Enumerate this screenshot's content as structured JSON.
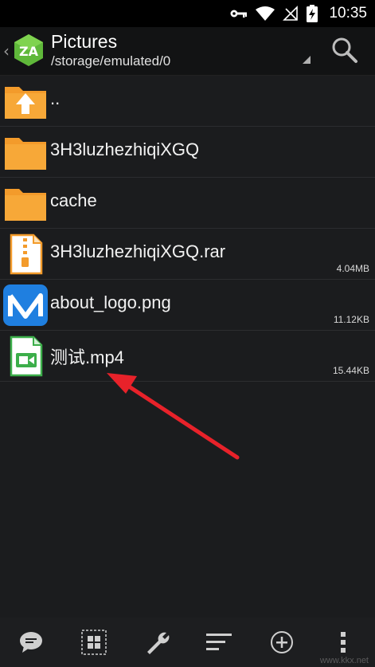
{
  "status_bar": {
    "time": "10:35",
    "icons": [
      "key-icon",
      "wifi-icon",
      "no-sim-icon",
      "battery-charging-icon"
    ]
  },
  "app_bar": {
    "title": "Pictures",
    "path": "/storage/emulated/0",
    "logo": "zarchiver-logo",
    "accent_color": "#5fb83a"
  },
  "files": [
    {
      "name": "..",
      "size": "",
      "icon": "folder-up-icon"
    },
    {
      "name": "3H3luzhezhiqiXGQ",
      "size": "",
      "icon": "folder-icon"
    },
    {
      "name": "cache",
      "size": "",
      "icon": "folder-icon"
    },
    {
      "name": "3H3luzhezhiqiXGQ.rar",
      "size": "4.04MB",
      "icon": "archive-file-icon"
    },
    {
      "name": "about_logo.png",
      "size": "11.12KB",
      "icon": "image-app-logo-icon"
    },
    {
      "name": "测试.mp4",
      "size": "15.44KB",
      "icon": "video-file-icon"
    }
  ],
  "bottom_bar": {
    "icons": [
      "chat-icon",
      "grid-select-icon",
      "wrench-icon",
      "sort-icon",
      "add-icon",
      "more-icon"
    ]
  },
  "watermark": "www.kkx.net"
}
